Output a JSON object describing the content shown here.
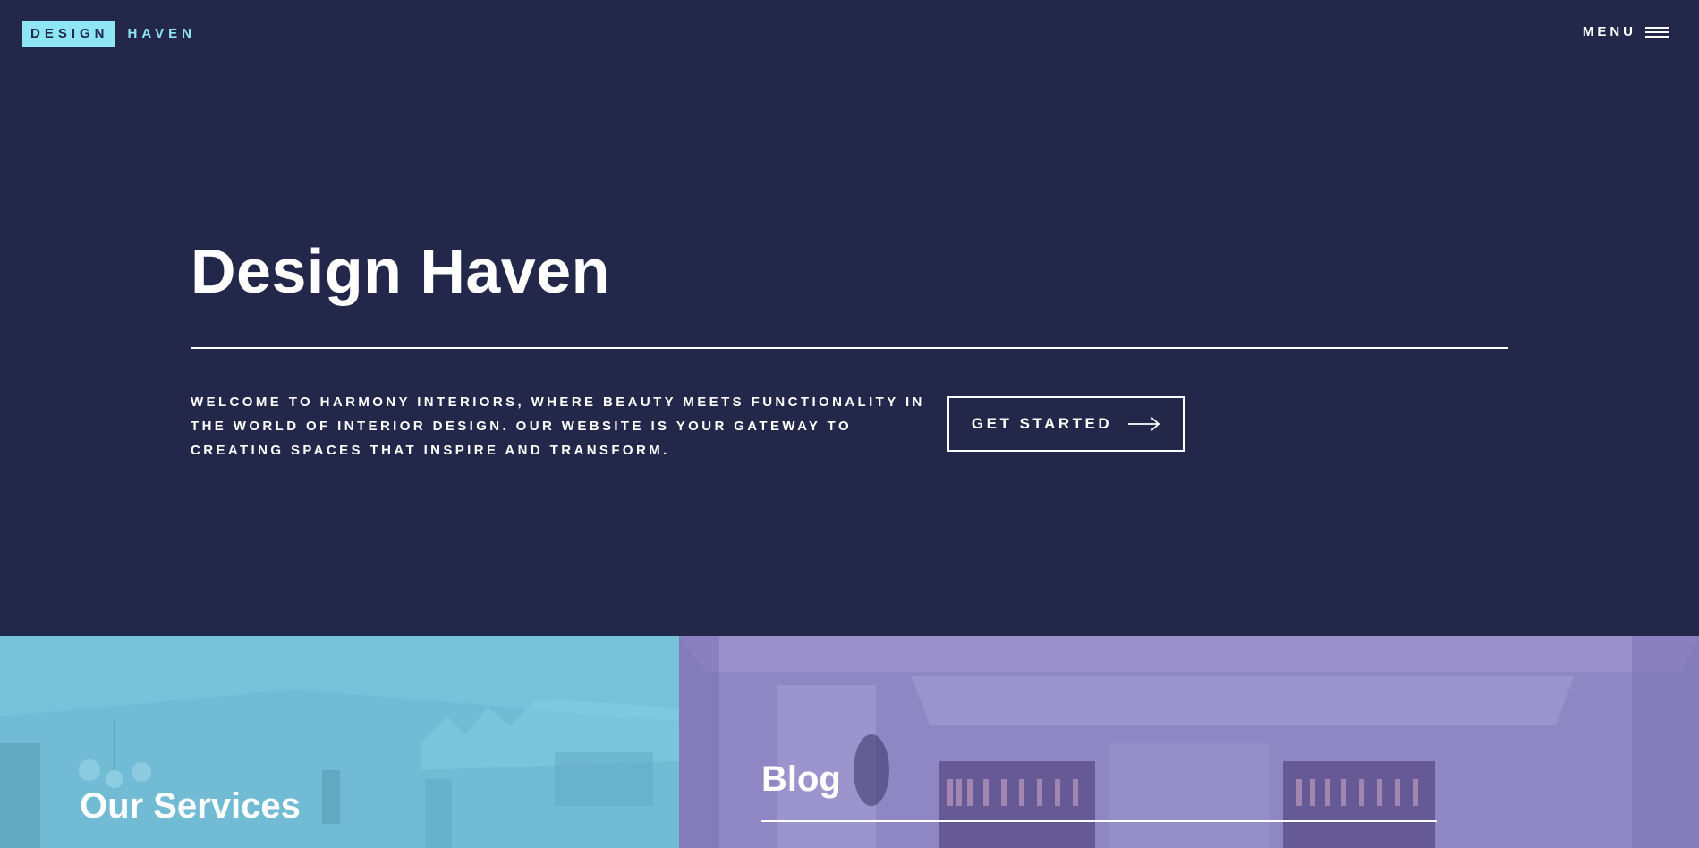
{
  "header": {
    "logo_box_text": "DESIGN",
    "logo_text": "HAVEN",
    "menu_label": "MENU",
    "menu_icon": "hamburger-icon"
  },
  "hero": {
    "title": "Design Haven",
    "description": "WELCOME TO HARMONY INTERIORS, WHERE BEAUTY MEETS FUNCTIONALITY IN THE WORLD OF INTERIOR DESIGN. OUR WEBSITE IS YOUR GATEWAY TO CREATING SPACES THAT INSPIRE AND TRANSFORM.",
    "cta_label": "GET STARTED",
    "cta_icon": "arrow-right-icon"
  },
  "panels": {
    "services_title": "Our Services",
    "blog_title": "Blog"
  },
  "colors": {
    "background": "#23284a",
    "accent": "#8ee6f5",
    "services_panel": "#72bdd5",
    "blog_panel": "#8f86c4"
  }
}
